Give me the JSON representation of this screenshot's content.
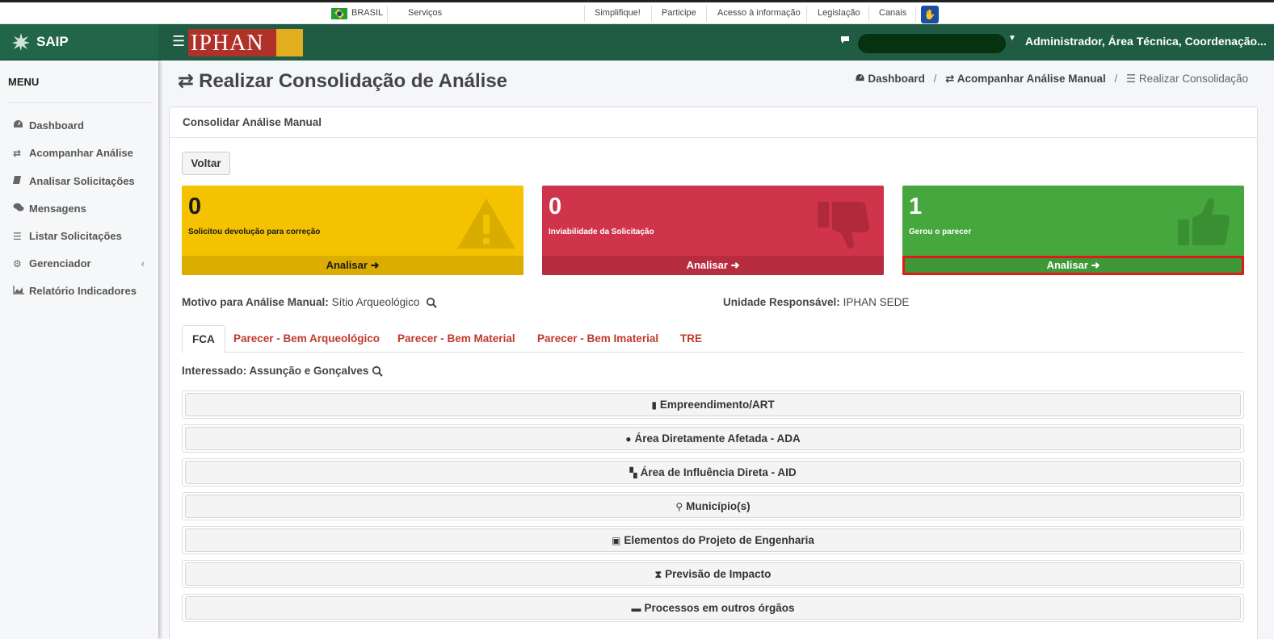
{
  "govbar": {
    "country": "BRASIL",
    "services": "Serviços",
    "links": [
      "Simplifique!",
      "Participe",
      "Acesso à informação",
      "Legislação",
      "Canais"
    ]
  },
  "header": {
    "app_name": "SAIP",
    "logo_text": "IPHAN",
    "user": "Administrador, Área Técnica, Coordenação..."
  },
  "sidebar": {
    "title": "MENU",
    "items": [
      {
        "label": "Dashboard",
        "icon": "dashboard-icon"
      },
      {
        "label": "Acompanhar Análise",
        "icon": "exchange-icon"
      },
      {
        "label": "Analisar Solicitações",
        "icon": "book-icon"
      },
      {
        "label": "Mensagens",
        "icon": "comments-icon"
      },
      {
        "label": "Listar Solicitações",
        "icon": "list-icon"
      },
      {
        "label": "Gerenciador",
        "icon": "gears-icon"
      },
      {
        "label": "Relatório Indicadores",
        "icon": "area-chart-icon"
      }
    ]
  },
  "page": {
    "title": "Realizar Consolidação de Análise",
    "breadcrumb": [
      "Dashboard",
      "Acompanhar Análise Manual",
      "Realizar Consolidação"
    ]
  },
  "card": {
    "title": "Consolidar Análise Manual",
    "back_label": "Voltar",
    "boxes": [
      {
        "count": "0",
        "label": "Solicitou devolução para correção",
        "action": "Analisar",
        "color": "#f4c200"
      },
      {
        "count": "0",
        "label": "Inviabilidade da Solicitação",
        "action": "Analisar",
        "color": "#d0344a"
      },
      {
        "count": "1",
        "label": "Gerou o parecer",
        "action": "Analisar",
        "color": "#47a73f"
      }
    ],
    "motivo_label": "Motivo para Análise Manual:",
    "motivo_value": "Sítio Arqueológico",
    "unidade_label": "Unidade Responsável:",
    "unidade_value": "IPHAN SEDE",
    "tabs": [
      "FCA",
      "Parecer - Bem Arqueológico",
      "Parecer - Bem Material",
      "Parecer - Bem Imaterial",
      "TRE"
    ],
    "interessado": "Interessado: Assunção e Gonçalves",
    "sections": [
      "Empreendimento/ART",
      "Área Diretamente Afetada - ADA",
      "Área de Influência Direta - AID",
      "Município(s)",
      "Elementos do Projeto de Engenharia",
      "Previsão de Impacto",
      "Processos em outros órgãos"
    ]
  }
}
